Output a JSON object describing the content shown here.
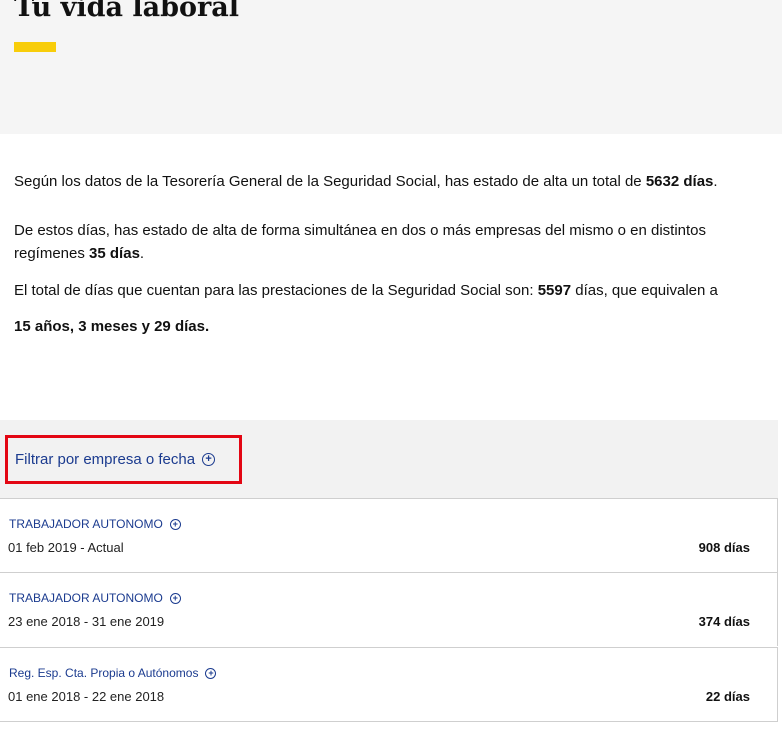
{
  "page": {
    "title": "Tu vida laboral"
  },
  "summary": {
    "p1_text": "Según los datos de la Tesorería General de la Seguridad Social, has estado de alta un total de",
    "p1_bold": "5632 días",
    "p2_text": "De estos días, has estado de alta de forma simultánea en dos o más empresas del mismo o en distintos regímenes",
    "p2_bold": "35 días",
    "p3_text": "El total de días que cuentan para las prestaciones de la Seguridad Social son:",
    "p3_bold": "5597",
    "p3_tail": "días, que equivalen a",
    "p4_bold": "15 años, 3 meses y 29 días."
  },
  "filter": {
    "label": "Filtrar por empresa o fecha",
    "icon": "plus-circle-icon"
  },
  "rows": [
    {
      "title": "TRABAJADOR AUTONOMO",
      "dates": "01 feb 2019 - Actual",
      "days": "908 días"
    },
    {
      "title": "TRABAJADOR AUTONOMO",
      "dates": "23 ene 2018 - 31 ene 2019",
      "days": "374 días"
    },
    {
      "title": "Reg. Esp. Cta. Propia o Autónomos",
      "dates": "01 ene 2018 - 22 ene 2018",
      "days": "22 días"
    }
  ],
  "colors": {
    "accent": "#f8cd0a",
    "link": "#1b3b8f",
    "highlight": "#e30613"
  }
}
